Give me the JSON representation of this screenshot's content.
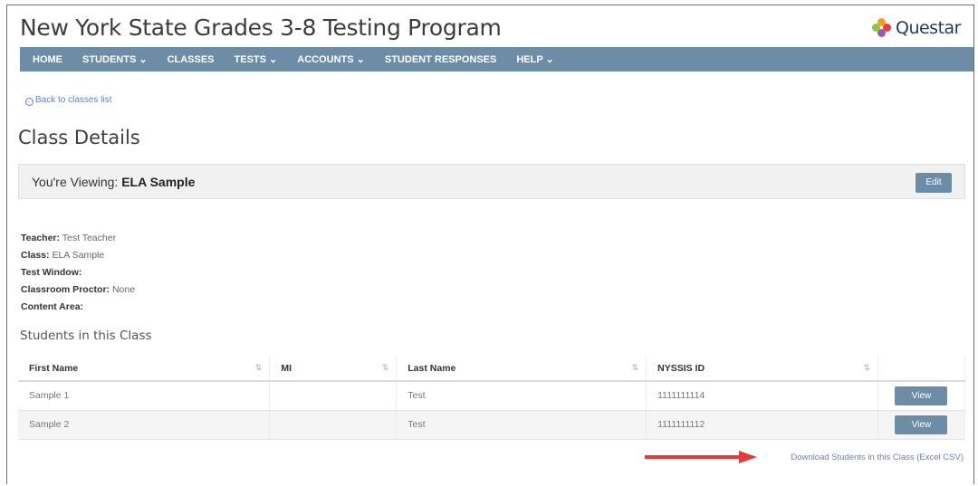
{
  "app": {
    "title": "New York State Grades 3-8 Testing Program",
    "logo_text": "Questar"
  },
  "nav": [
    "HOME",
    "STUDENTS ⌄",
    "CLASSES",
    "TESTS ⌄",
    "ACCOUNTS ⌄",
    "STUDENT RESPONSES",
    "HELP ⌄"
  ],
  "back_link": "Back to classes list",
  "page_title": "Class Details",
  "viewing": {
    "prefix": "You're Viewing:",
    "name": "ELA Sample",
    "edit_label": "Edit"
  },
  "details": [
    {
      "label": "Teacher:",
      "value": "Test Teacher"
    },
    {
      "label": "Class:",
      "value": "ELA Sample"
    },
    {
      "label": "Test Window:",
      "value": ""
    },
    {
      "label": "Classroom Proctor:",
      "value": "None"
    },
    {
      "label": "Content Area:",
      "value": ""
    }
  ],
  "students_title": "Students in this Class",
  "table": {
    "columns": [
      "First Name",
      "MI",
      "Last Name",
      "NYSSIS ID"
    ],
    "sort_icons": [
      "⇅",
      "⇅",
      "⇅",
      "⇅"
    ],
    "rows": [
      {
        "first": "Sample 1",
        "mi": "",
        "last": "Test",
        "id": "1111111114",
        "action": "View"
      },
      {
        "first": "Sample 2",
        "mi": "",
        "last": "Test",
        "id": "1111111112",
        "action": "View"
      }
    ]
  },
  "download_link": "Download Students in this Class (Excel CSV)",
  "colors": {
    "nav": "#6d8ca6",
    "link": "#6a7dc0",
    "arrow": "#e03c3c"
  },
  "icons": [
    "back-circle-icon",
    "sort-icon",
    "questar-logo-icon",
    "red-arrow-annotation"
  ]
}
